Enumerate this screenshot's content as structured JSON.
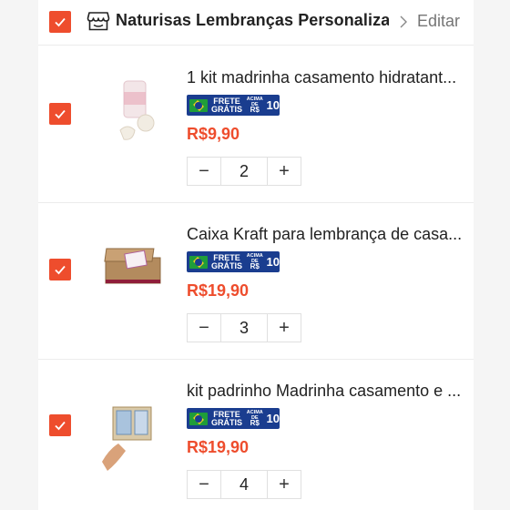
{
  "shop": {
    "name": "Naturisas Lembranças Personaliza...",
    "edit_label": "Editar"
  },
  "badge": {
    "frete_line1": "FRETE",
    "frete_line2": "GRÁTIS",
    "acima_line1": "ACIMA DE",
    "currency": "R$",
    "threshold": "10"
  },
  "items": [
    {
      "title": "1 kit madrinha casamento hidratant...",
      "price": "R$9,90",
      "quantity": "2",
      "selected": true
    },
    {
      "title": "Caixa Kraft para lembrança de casa...",
      "price": "R$19,90",
      "quantity": "3",
      "selected": true
    },
    {
      "title": "kit padrinho Madrinha casamento e ...",
      "price": "R$19,90",
      "quantity": "4",
      "selected": true
    }
  ],
  "stepper": {
    "minus": "−",
    "plus": "+"
  },
  "colors": {
    "accent": "#ee4d2d",
    "badge_bg": "#1a3d8f"
  }
}
